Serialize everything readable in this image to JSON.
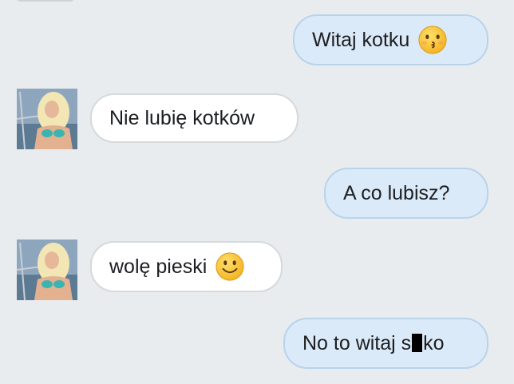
{
  "messages": [
    {
      "from": "me",
      "text": "Witaj kotku",
      "emoji": "kissing-face-icon"
    },
    {
      "from": "them",
      "text": "Nie lubię kotków"
    },
    {
      "from": "me",
      "text": "A co lubisz?"
    },
    {
      "from": "them",
      "text": "wolę pieski",
      "emoji": "smiling-face-icon"
    },
    {
      "from": "me",
      "text_before": "No to witaj s",
      "text_after": "ko",
      "censored": true
    }
  ],
  "colors": {
    "background": "#e9ecef",
    "sent_bubble": "#dbeaf8",
    "received_bubble": "#ffffff",
    "emoji_yellow": "#f8c62c"
  }
}
